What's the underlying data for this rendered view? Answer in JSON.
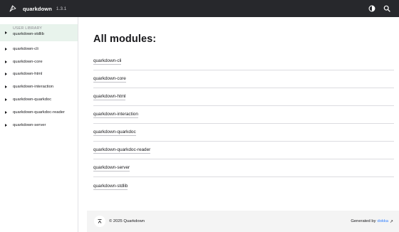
{
  "header": {
    "app_name": "quarkdown",
    "version": "1.3.1",
    "logo_icon": "quarkdown-logo-icon",
    "theme_toggle_icon": "theme-toggle-icon",
    "search_icon": "search-icon"
  },
  "sidebar": {
    "active": {
      "section_label": "USER LIBRARY",
      "label": "quarkdown-stdlib"
    },
    "items": [
      {
        "label": "quarkdown-cli"
      },
      {
        "label": "quarkdown-core"
      },
      {
        "label": "quarkdown-html"
      },
      {
        "label": "quarkdown-interaction"
      },
      {
        "label": "quarkdown-quarkdoc"
      },
      {
        "label": "quarkdown-quarkdoc-reader"
      },
      {
        "label": "quarkdown-server"
      }
    ]
  },
  "main": {
    "title": "All modules:",
    "modules": [
      "quarkdown-cli",
      "quarkdown-core",
      "quarkdown-html",
      "quarkdown-interaction",
      "quarkdown-quarkdoc",
      "quarkdown-quarkdoc-reader",
      "quarkdown-server",
      "quarkdown-stdlib"
    ]
  },
  "footer": {
    "copyright": "© 2025 Quarkdown",
    "generated_prefix": "Generated by",
    "generator": "dokka",
    "link_color": "#307fff"
  },
  "colors": {
    "navbar_bg": "#27282c",
    "active_item_bg": "#e8f3ec",
    "footer_bg": "#f4f4f4"
  }
}
